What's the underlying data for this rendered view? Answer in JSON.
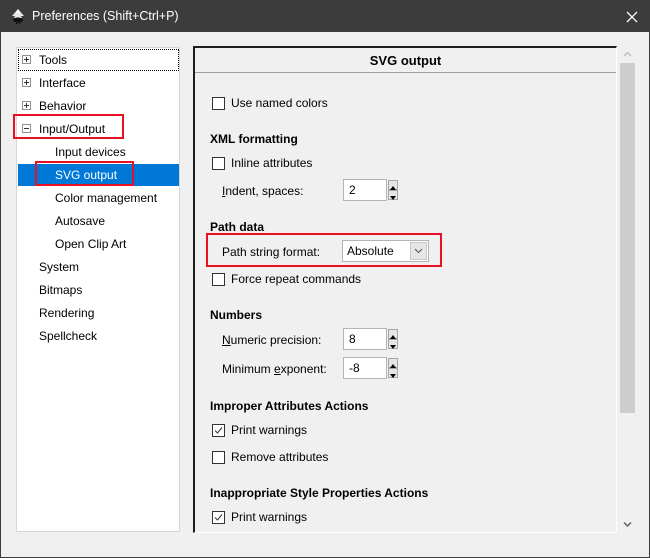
{
  "window": {
    "title": "Preferences (Shift+Ctrl+P)",
    "app_icon": "inkscape-logo-icon",
    "close_icon": "close-icon"
  },
  "tree": {
    "items": [
      {
        "label": "Tools",
        "level": 0,
        "expander": "plus",
        "focused": true
      },
      {
        "label": "Interface",
        "level": 0,
        "expander": "plus"
      },
      {
        "label": "Behavior",
        "level": 0,
        "expander": "plus"
      },
      {
        "label": "Input/Output",
        "level": 0,
        "expander": "minus",
        "highlighted": true
      },
      {
        "label": "Input devices",
        "level": 1
      },
      {
        "label": "SVG output",
        "level": 1,
        "selected": true,
        "highlighted": true
      },
      {
        "label": "Color management",
        "level": 1
      },
      {
        "label": "Autosave",
        "level": 1
      },
      {
        "label": "Open Clip Art",
        "level": 1
      },
      {
        "label": "System",
        "level": 0
      },
      {
        "label": "Bitmaps",
        "level": 0
      },
      {
        "label": "Rendering",
        "level": 0
      },
      {
        "label": "Spellcheck",
        "level": 0
      }
    ]
  },
  "panel": {
    "title": "SVG output",
    "use_named_colors": {
      "label": "Use named colors",
      "checked": false
    },
    "xml_formatting": {
      "heading": "XML formatting",
      "inline_attributes": {
        "label": "Inline attributes",
        "checked": false
      },
      "indent": {
        "label_pre": "",
        "label_mnemonic": "I",
        "label_post": "ndent, spaces:",
        "value": "2"
      }
    },
    "path_data": {
      "heading": "Path data",
      "path_string_format": {
        "label": "Path string format:",
        "value": "Absolute"
      },
      "force_repeat": {
        "label": "Force repeat commands",
        "checked": false
      }
    },
    "numbers": {
      "heading": "Numbers",
      "numeric_precision": {
        "label_mnemonic": "N",
        "label_post": "umeric precision:",
        "value": "8"
      },
      "minimum_exponent": {
        "label_pre": "Minimum ",
        "label_mnemonic": "e",
        "label_post": "xponent:",
        "value": "-8"
      }
    },
    "improper_attributes": {
      "heading": "Improper Attributes Actions",
      "print_warnings": {
        "label": "Print warnings",
        "checked": true
      },
      "remove_attributes": {
        "label": "Remove attributes",
        "checked": false
      }
    },
    "inappropriate_style": {
      "heading": "Inappropriate Style Properties Actions",
      "print_warnings": {
        "label": "Print warnings",
        "checked": true
      }
    }
  },
  "colors": {
    "titlebar": "#3c3c3c",
    "selection": "#0078d7",
    "highlight_box": "#e81123"
  }
}
